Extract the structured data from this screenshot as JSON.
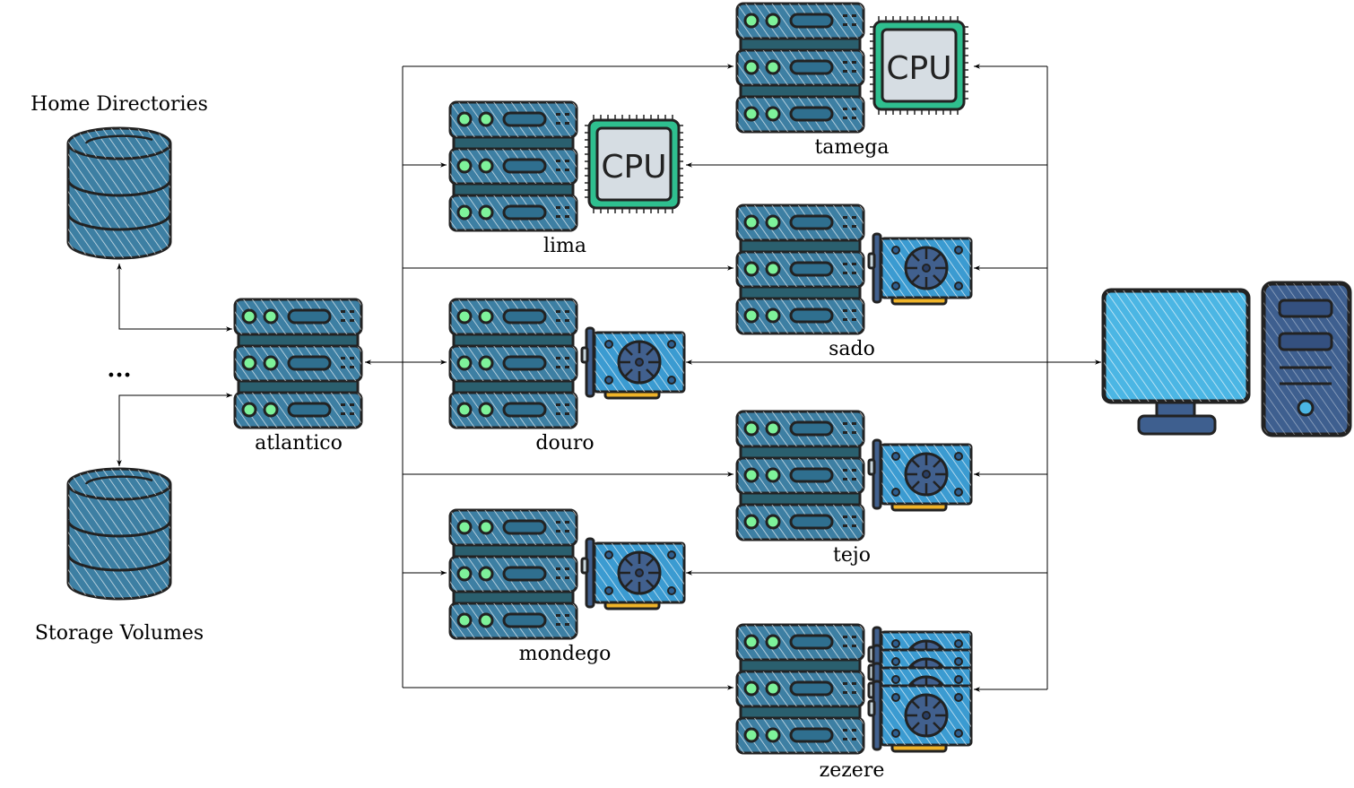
{
  "storage": {
    "home_label": "Home Directories",
    "ellipsis": "...",
    "volumes_label": "Storage Volumes"
  },
  "nodes": {
    "atlantico": "atlantico",
    "tamega": "tamega",
    "lima": "lima",
    "sado": "sado",
    "douro": "douro",
    "tejo": "tejo",
    "mondego": "mondego",
    "zezere": "zezere"
  },
  "cpu_text": "CPU",
  "icons": {
    "server": "server-rack-icon",
    "cpu": "cpu-chip-icon",
    "gpu": "graphics-card-icon",
    "database": "database-icon",
    "workstation": "desktop-computer-icon"
  },
  "colors": {
    "server": "#3d7fa3",
    "server_dark": "#2a5f6e",
    "led": "#7ef29a",
    "gpu_board": "#3b9bd1",
    "gpu_fan": "#41608e",
    "gpu_connector": "#f0b429",
    "cpu_border": "#2fbf8f",
    "cpu_core": "#d6dde3",
    "monitor_screen": "#4bb6e4",
    "tower": "#3e5f8f"
  }
}
